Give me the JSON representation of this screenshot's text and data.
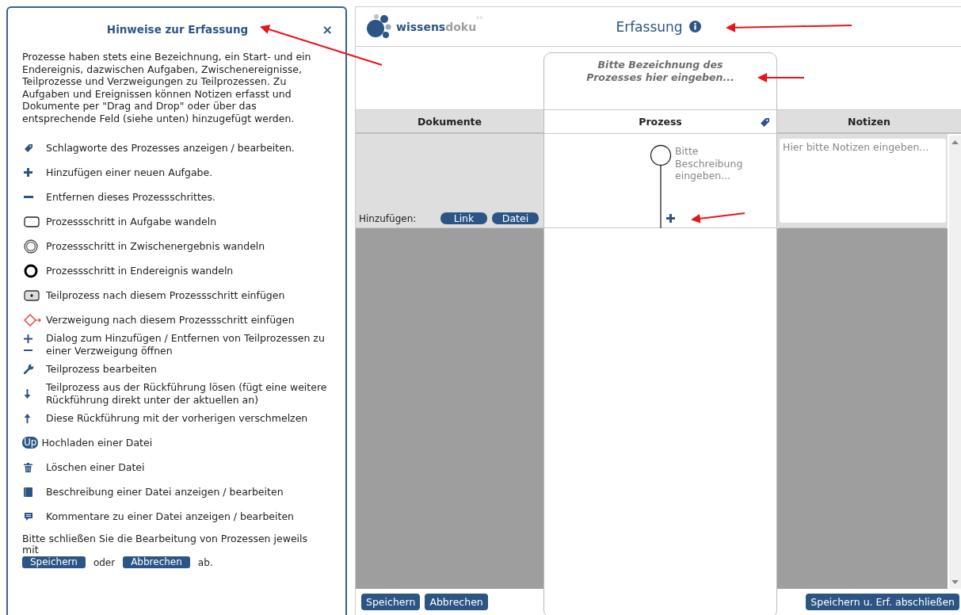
{
  "help_panel": {
    "title": "Hinweise zur Erfassung",
    "close": "×",
    "intro": "Prozesse haben stets eine Bezeichnung, ein Start- und ein Endereignis, dazwischen Aufgaben, Zwischenereignisse, Teilprozesse und Verzweigungen zu Teilprozessen. Zu Aufgaben und Ereignissen können Notizen erfasst und Dokumente per \"Drag and Drop\" oder über das entsprechende Feld (siehe unten) hinzugefügt werden.",
    "items": [
      {
        "kind": "tag",
        "text": "Schlagworte des Prozesses anzeigen / bearbeiten."
      },
      {
        "kind": "plus",
        "text": "Hinzufügen einer neuen Aufgabe."
      },
      {
        "kind": "minus",
        "text": "Entfernen dieses Prozessschrittes."
      },
      {
        "kind": "task",
        "text": "Prozessschritt in Aufgabe wandeln"
      },
      {
        "kind": "intermediate",
        "text": "Prozessschritt in Zwischenergebnis wandeln"
      },
      {
        "kind": "end",
        "text": "Prozessschritt in Endereignis wandeln"
      },
      {
        "kind": "subprocess",
        "text": "Teilprozess nach diesem Prozessschritt einfügen"
      },
      {
        "kind": "branch",
        "text": "Verzweigung nach diesem Prozessschritt einfügen"
      },
      {
        "kind": "plusminus",
        "text": "Dialog zum Hinzufügen / Entfernen von Teilprozessen zu einer Verzweigung öffnen"
      },
      {
        "kind": "wrench",
        "text": "Teilprozess bearbeiten"
      },
      {
        "kind": "down",
        "text": "Teilprozess aus der Rückführung lösen (fügt eine weitere Rückführung direkt unter der aktuellen an)"
      },
      {
        "kind": "up",
        "text": "Diese Rückführung mit der vorherigen verschmelzen"
      },
      {
        "kind": "upload",
        "badge": "Up",
        "text": "Hochladen einer Datei"
      },
      {
        "kind": "trash",
        "text": "Löschen einer Datei"
      },
      {
        "kind": "book",
        "text": "Beschreibung einer Datei anzeigen / bearbeiten"
      },
      {
        "kind": "comment",
        "text": "Kommentare zu einer Datei anzeigen / bearbeiten"
      }
    ],
    "closing": {
      "text": "Bitte schließen Sie die Bearbeitung von Prozessen jeweils mit",
      "save": "Speichern",
      "or": "oder",
      "cancel": "Abbrechen",
      "end": "ab."
    }
  },
  "header": {
    "logo": {
      "part_1": "wissens",
      "part_2": "doku",
      "version": "2.0"
    },
    "title": "Erfassung"
  },
  "process_name": {
    "placeholder": "Bitte Bezeichnung des Prozesses hier eingeben..."
  },
  "columns": [
    "Dokumente",
    "Prozess",
    "Notizen"
  ],
  "documents": {
    "add_label": "Hinzufügen:",
    "add_buttons": [
      "Link",
      "Datei"
    ]
  },
  "step": {
    "placeholder": "Bitte Beschreibung eingeben..."
  },
  "notes": {
    "placeholder": "Hier bitte Notizen eingeben..."
  },
  "footer": {
    "left_buttons": [
      "Speichern",
      "Abbrechen"
    ],
    "right_button": "Speichern u. Erf. abschließen"
  }
}
